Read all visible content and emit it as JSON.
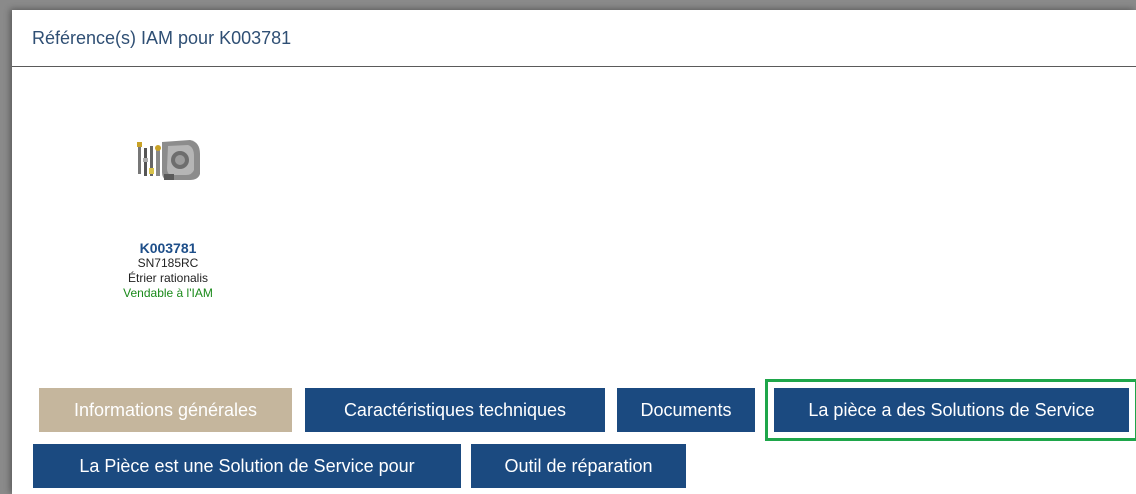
{
  "header": {
    "title": "Référence(s) IAM pour K003781"
  },
  "product": {
    "image_icon": "brake-caliper-kit-image",
    "code": "K003781",
    "reference": "SN7185RC",
    "description": "Étrier rationalis",
    "status": "Vendable à l'IAM"
  },
  "tabs": [
    {
      "label": "Informations générales",
      "active": true
    },
    {
      "label": "Caractéristiques techniques",
      "active": false
    },
    {
      "label": "Documents",
      "active": false
    },
    {
      "label": "La pièce a des Solutions de Service",
      "active": false,
      "highlighted": true
    },
    {
      "label": "La Pièce est une Solution de Service pour",
      "active": false
    },
    {
      "label": "Outil de réparation",
      "active": false
    }
  ],
  "colors": {
    "tab_bg": "#1b4a80",
    "tab_active_bg": "#c5b69d",
    "highlight_border": "#1ea64a",
    "status_green": "#1a8a1a"
  }
}
